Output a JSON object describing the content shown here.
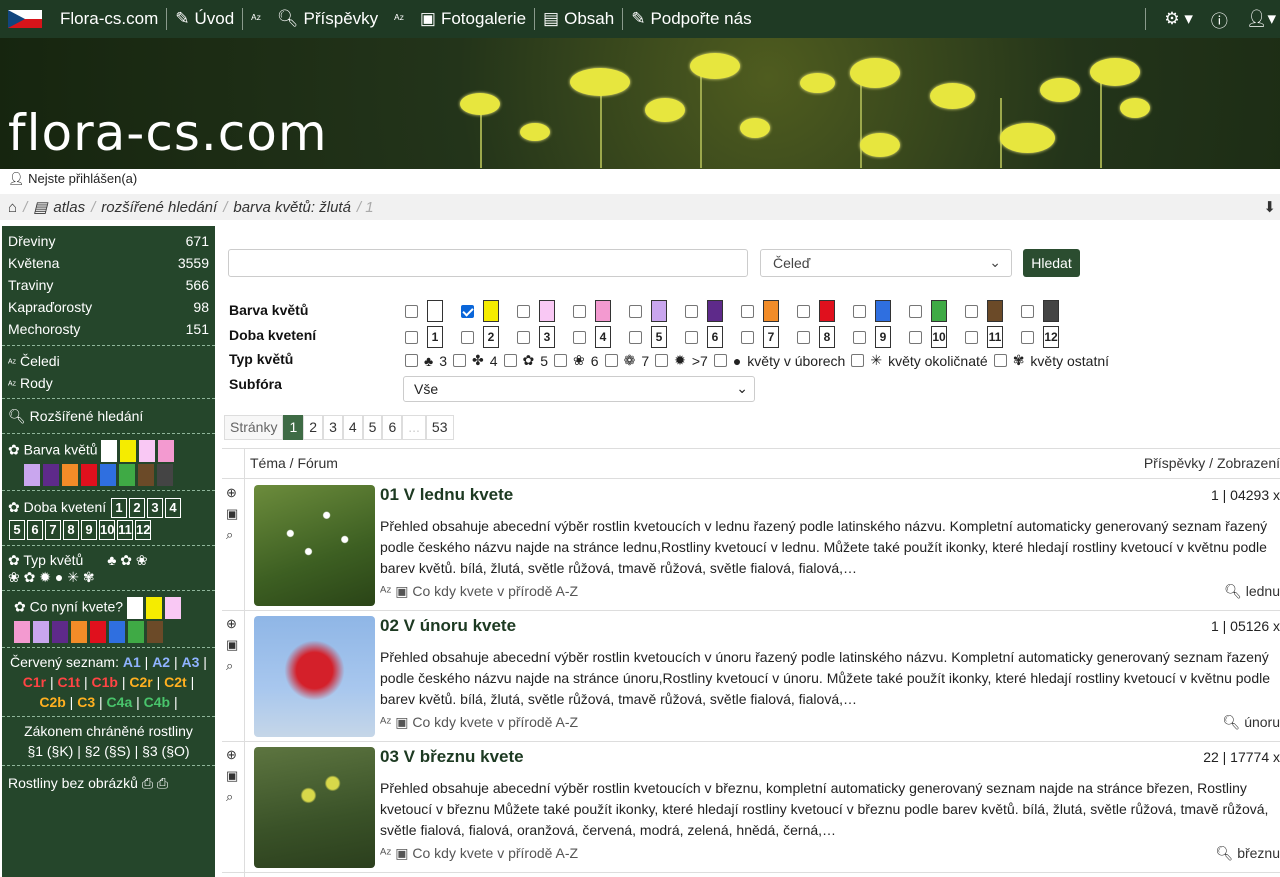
{
  "nav": {
    "site": "Flora-cs.com",
    "uvod": "Úvod",
    "prispevky": "Příspěvky",
    "fotogalerie": "Fotogalerie",
    "obsah": "Obsah",
    "podporte": "Podpořte nás"
  },
  "banner": {
    "logo": "flora-cs.com"
  },
  "login": "Nejste přihlášen(a)",
  "breadcrumb": {
    "atlas": "atlas",
    "rozsirene": "rozšířené hledání",
    "barva": "barva květů: žlutá",
    "page": "/ 1"
  },
  "sidebar": {
    "categories": [
      {
        "label": "Dřeviny",
        "count": "671"
      },
      {
        "label": "Květena",
        "count": "3559"
      },
      {
        "label": "Traviny",
        "count": "566"
      },
      {
        "label": "Kapraďorosty",
        "count": "98"
      },
      {
        "label": "Mechorosty",
        "count": "151"
      }
    ],
    "celedi": "Čeledi",
    "rody": "Rody",
    "rozsirene": "Rozšířené hledání",
    "barva": "Barva květů",
    "doba": "Doba kvetení",
    "typ": "Typ květů",
    "nyni": "Co nyní kvete?",
    "cerveny": "Červený seznam:",
    "redlist": [
      "A1",
      "A2",
      "A3",
      "C1r",
      "C1t",
      "C1b",
      "C2r",
      "C2t",
      "C2b",
      "C3",
      "C4a",
      "C4b"
    ],
    "zakon1": "Zákonem chráněné rostliny",
    "zakon2": "§1 (§K) | §2 (§S) | §3 (§O)",
    "bez": "Rostliny bez obrázků",
    "months": [
      "1",
      "2",
      "3",
      "4",
      "5",
      "6",
      "7",
      "8",
      "9",
      "10",
      "11",
      "12"
    ]
  },
  "colors": {
    "palette": [
      "#ffffff",
      "#f5ec00",
      "#f9c8f4",
      "#f39ad0",
      "#c9a6ee",
      "#5e2a8a",
      "#f28c28",
      "#e0101d",
      "#2f6fe0",
      "#3faa45",
      "#6b4a28",
      "#444444"
    ]
  },
  "search": {
    "placeholder": "",
    "family": "Čeleď",
    "button": "Hledat",
    "labels": {
      "barva": "Barva květů",
      "doba": "Doba kvetení",
      "typ": "Typ květů",
      "subfora": "Subfóra"
    },
    "typ": [
      "3",
      "4",
      "5",
      "6",
      "7",
      ">7",
      "květy v úborech",
      "květy okoličnaté",
      "květy ostatní"
    ],
    "subfora": "Vše"
  },
  "pager": {
    "label": "Stránky",
    "pages": [
      "1",
      "2",
      "3",
      "4",
      "5",
      "6",
      "...",
      "53"
    ]
  },
  "table": {
    "col1": "Téma / Fórum",
    "col2": "Příspěvky / Zobrazení"
  },
  "posts": [
    {
      "title": "01 V lednu kvete",
      "stat": "1 | 04293 x",
      "desc": "Přehled obsahuje abecední výběr rostlin kvetoucích v lednu řazený podle latinského názvu. Kompletní automaticky generovaný seznam řazený podle českého názvu najde na stránce lednu,Rostliny kvetoucí v lednu. Můžete také použít ikonky, které hledají rostliny kvetoucí v květnu podle barev květů. bílá, žlutá, světle růžová, tmavě růžová, světle fialová, fialová,…",
      "foot": "Co kdy kvete v přírodě A-Z",
      "tag": "lednu"
    },
    {
      "title": "02 V únoru kvete",
      "stat": "1 | 05126 x",
      "desc": "Přehled obsahuje abecední výběr rostlin kvetoucích v únoru řazený podle latinského názvu. Kompletní automaticky generovaný seznam řazený podle českého názvu najde na stránce únoru,Rostliny kvetoucí v únoru. Můžete také použít ikonky, které hledají rostliny kvetoucí v květnu podle barev květů. bílá, žlutá, světle růžová, tmavě růžová, světle fialová, fialová,…",
      "foot": "Co kdy kvete v přírodě A-Z",
      "tag": "únoru"
    },
    {
      "title": "03 V březnu kvete",
      "stat": "22 | 17774 x",
      "desc": "Přehled obsahuje abecední výběr rostlin kvetoucích v březnu, kompletní automaticky generovaný seznam najde na stránce březen, Rostliny kvetoucí v březnu Můžete také použít ikonky, které hledají rostliny kvetoucí v březnu podle barev květů. bílá, žlutá, světle růžová, tmavě růžová, světle fialová, fialová, oranžová, červená, modrá, zelená, hnědá, černá,…",
      "foot": "Co kdy kvete v přírodě A-Z",
      "tag": "březnu"
    }
  ]
}
